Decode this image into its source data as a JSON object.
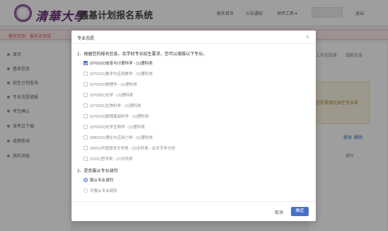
{
  "header": {
    "logo_text": "清華大學",
    "system_title": "强基计划报名系统",
    "nav": [
      "报名首页",
      "公告通知",
      "测评工具 ▾",
      "退出"
    ]
  },
  "status": {
    "text": "报名状态：报名未完成"
  },
  "sidebar": {
    "items": [
      {
        "label": "首页"
      },
      {
        "label": "基本信息"
      },
      {
        "label": "招生计划查询"
      },
      {
        "label": "专业志愿填报"
      },
      {
        "label": "考生确认"
      },
      {
        "label": "准考证下载"
      },
      {
        "label": "成绩查询"
      },
      {
        "label": "我的消息"
      }
    ]
  },
  "background": {
    "upload_label": "上传志愿表",
    "complete_label": "填报完成",
    "yellow_text": "志愿需满足招生专业目",
    "edit_label": "修改",
    "delete_label": "删除",
    "op_header": "操作"
  },
  "modal": {
    "title": "专业志愿",
    "q1": "1、根据您的报名信息，及学校专业招生要求，您可以填报以下专业。",
    "options": [
      {
        "label": "(070102)信息与计算科学 - (1)理科类",
        "checked": true
      },
      {
        "label": "(070101)数学与应用数学 - (1)理科类",
        "checked": false
      },
      {
        "label": "(070201)物理学 - (1)理科类",
        "checked": false
      },
      {
        "label": "(070301)化学 - (1)理科类",
        "checked": false
      },
      {
        "label": "(071001)生物科学 - (1)理科类",
        "checked": false
      },
      {
        "label": "(070103)数理基础科学 - (1)理科类",
        "checked": false
      },
      {
        "label": "(070303)化学生物学 - (1)理科类",
        "checked": false
      },
      {
        "label": "(080101)理论与应用力学 - (1)理科类",
        "checked": false
      },
      {
        "label": "(0501)中国语言文学类 - (2)文科类 - 古文字学方向",
        "checked": false
      },
      {
        "label": "(0101)哲学类 - (2)文科类",
        "checked": false
      }
    ],
    "q2": "2、是否服从专业调剂",
    "radios": [
      {
        "label": "服从专业调剂",
        "checked": true
      },
      {
        "label": "不服从专业调剂",
        "checked": false
      }
    ],
    "cancel_label": "取消",
    "ok_label": "确定"
  }
}
